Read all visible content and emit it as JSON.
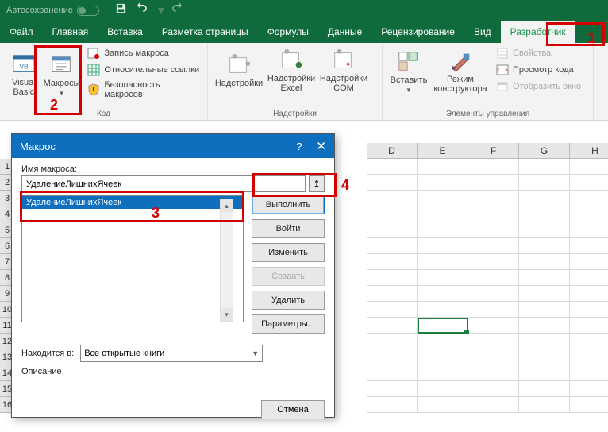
{
  "titlebar": {
    "autosave": "Автосохранение"
  },
  "tabs": {
    "file": "Файл",
    "home": "Главная",
    "insert": "Вставка",
    "pagelayout": "Разметка страницы",
    "formulas": "Формулы",
    "data": "Данные",
    "review": "Рецензирование",
    "view": "Вид",
    "developer": "Разработчик"
  },
  "ribbon": {
    "vb": "Visual\nBasic",
    "macros": "Макросы",
    "record": "Запись макроса",
    "relative": "Относительные ссылки",
    "security": "Безопасность макросов",
    "code_group": "Код",
    "addins": "Надстройки",
    "excel_addins": "Надстройки\nExcel",
    "com_addins": "Надстройки\nCOM",
    "addins_group": "Надстройки",
    "insert": "Вставить",
    "design": "Режим\nконструктора",
    "properties": "Свойства",
    "viewcode": "Просмотр кода",
    "rundialog": "Отобразить окно",
    "controls_group": "Элементы управления"
  },
  "columns": [
    "D",
    "E",
    "F",
    "G",
    "H"
  ],
  "rows": [
    "1",
    "2",
    "3",
    "4",
    "5",
    "6",
    "7",
    "8",
    "9",
    "10",
    "11",
    "12",
    "13",
    "14",
    "15",
    "16"
  ],
  "dialog": {
    "title": "Макрос",
    "name_label": "Имя макроса:",
    "name_value": "УдалениеЛишнихЯчеек",
    "list": [
      "УдалениеЛишнихЯчеек"
    ],
    "run": "Выполнить",
    "stepinto": "Войти",
    "edit": "Изменить",
    "create": "Создать",
    "delete": "Удалить",
    "options": "Параметры...",
    "location_label": "Находится в:",
    "location_value": "Все открытые книги",
    "description_label": "Описание",
    "cancel": "Отмена"
  },
  "annotations": {
    "1": "1",
    "2": "2",
    "3": "3",
    "4": "4"
  }
}
